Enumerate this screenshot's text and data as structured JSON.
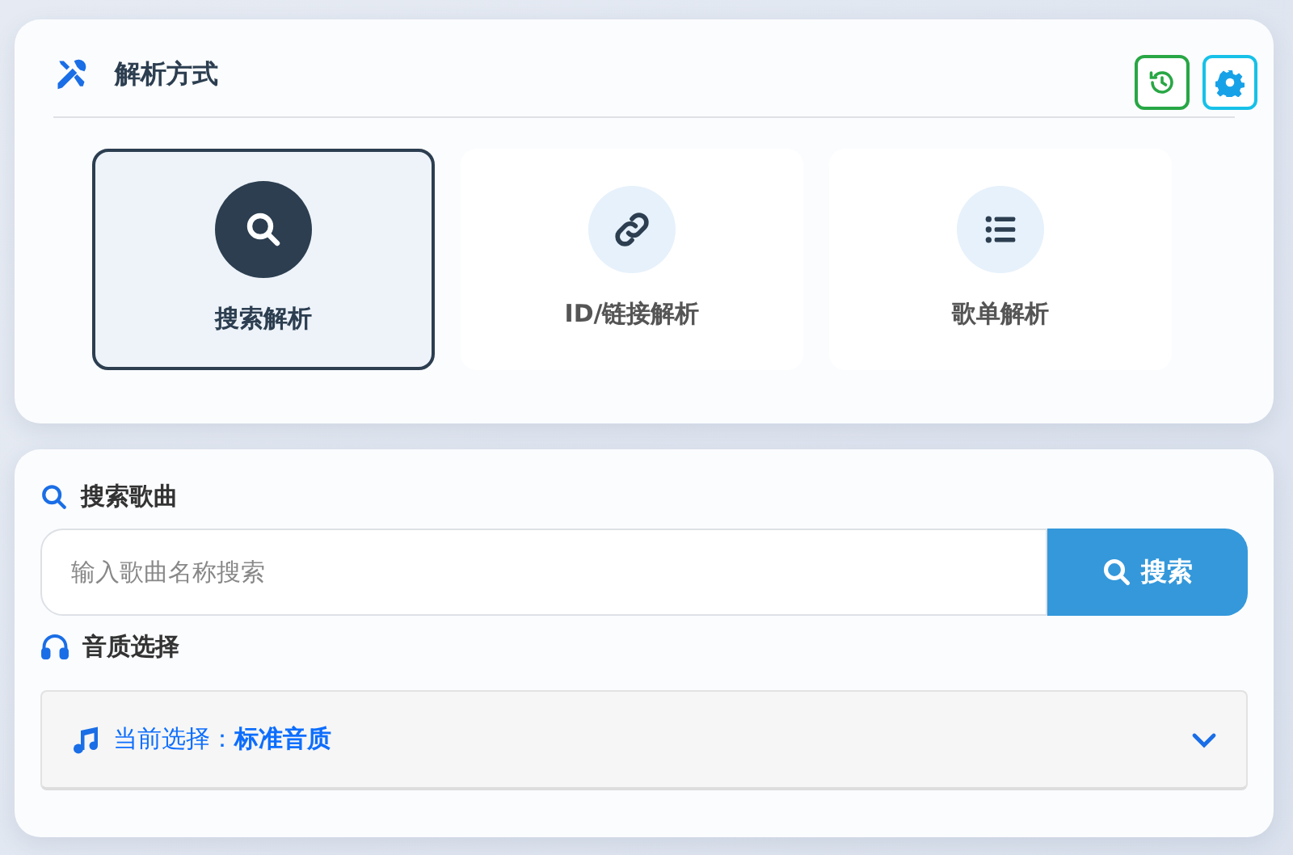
{
  "method_panel": {
    "title": "解析方式",
    "methods": [
      {
        "kind": "search",
        "label": "搜索解析",
        "selected": true
      },
      {
        "kind": "link",
        "label": "ID/链接解析",
        "selected": false
      },
      {
        "kind": "list",
        "label": "歌单解析",
        "selected": false
      }
    ]
  },
  "search": {
    "title": "搜索歌曲",
    "placeholder": "输入歌曲名称搜索",
    "button": "搜索"
  },
  "quality": {
    "title": "音质选择",
    "current": "当前选择：**标准音质**",
    "expanded": false
  }
}
